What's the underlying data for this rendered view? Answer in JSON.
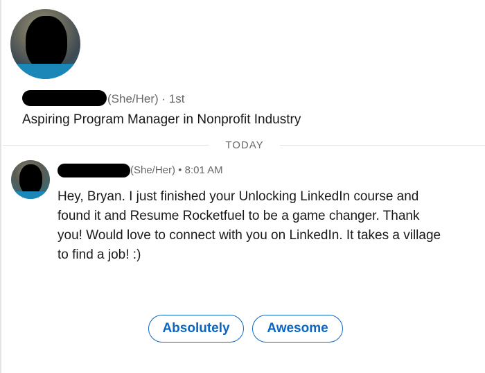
{
  "profile": {
    "pronouns_degree": "(She/Her) · 1st",
    "headline": "Aspiring Program Manager in Nonprofit Industry"
  },
  "divider": {
    "label": "TODAY"
  },
  "message": {
    "meta": "(She/Her) • 8:01 AM",
    "body": "Hey, Bryan. I just finished your Unlocking LinkedIn course and found it and Resume Rocketfuel to be a game changer. Thank you! Would love to connect with you on LinkedIn. It takes a village to find a job! :)"
  },
  "quick_replies": [
    {
      "label": "Absolutely"
    },
    {
      "label": "Awesome"
    }
  ],
  "colors": {
    "accent": "#0a66c2",
    "muted_text": "#666666",
    "body_text": "#191919",
    "divider": "#e3e3e3"
  }
}
